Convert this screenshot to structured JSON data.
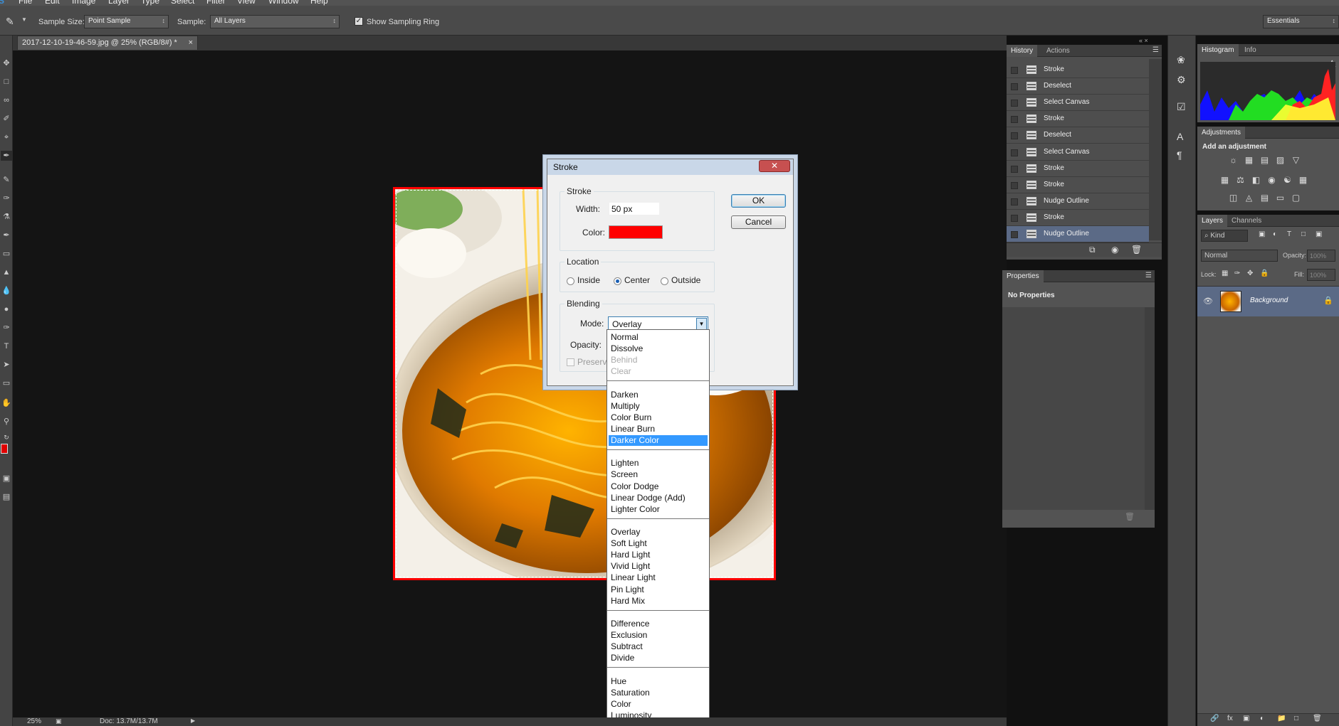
{
  "menu": [
    "File",
    "Edit",
    "Image",
    "Layer",
    "Type",
    "Select",
    "Filter",
    "View",
    "Window",
    "Help"
  ],
  "options": {
    "sample_size_label": "Sample Size:",
    "sample_size_value": "Point Sample",
    "sample_label": "Sample:",
    "sample_value": "All Layers",
    "show_ring_label": "Show Sampling Ring",
    "workspace": "Essentials"
  },
  "document": {
    "tab_title": "2017-12-10-19-46-59.jpg @ 25% (RGB/8#) *",
    "close_glyph": "×"
  },
  "status": {
    "zoom": "25%",
    "doc_info": "Doc: 13.7M/13.7M"
  },
  "stroke_dialog": {
    "title": "Stroke",
    "close_glyph": "✕",
    "stroke_group": "Stroke",
    "width_label": "Width:",
    "width_value": "50 px",
    "color_label": "Color:",
    "stroke_color": "#ff0000",
    "location_group": "Location",
    "loc_inside": "Inside",
    "loc_center": "Center",
    "loc_outside": "Outside",
    "blending_group": "Blending",
    "mode_label": "Mode:",
    "mode_value": "Overlay",
    "opacity_label": "Opacity:",
    "preserve_label": "Preserv",
    "ok": "OK",
    "cancel": "Cancel"
  },
  "blend_modes": [
    [
      "Normal",
      "Dissolve",
      "Behind",
      "Clear"
    ],
    [
      "Darken",
      "Multiply",
      "Color Burn",
      "Linear Burn",
      "Darker Color"
    ],
    [
      "Lighten",
      "Screen",
      "Color Dodge",
      "Linear Dodge (Add)",
      "Lighter Color"
    ],
    [
      "Overlay",
      "Soft Light",
      "Hard Light",
      "Vivid Light",
      "Linear Light",
      "Pin Light",
      "Hard Mix"
    ],
    [
      "Difference",
      "Exclusion",
      "Subtract",
      "Divide"
    ],
    [
      "Hue",
      "Saturation",
      "Color",
      "Luminosity"
    ]
  ],
  "blend_modes_disabled": [
    "Behind",
    "Clear"
  ],
  "blend_mode_highlighted": "Darker Color",
  "history": {
    "tabs": [
      "History",
      "Actions"
    ],
    "items": [
      "Stroke",
      "Deselect",
      "Select Canvas",
      "Stroke",
      "Deselect",
      "Select Canvas",
      "Stroke",
      "Stroke",
      "Nudge Outline",
      "Stroke",
      "Nudge Outline"
    ]
  },
  "properties": {
    "title": "Properties",
    "empty": "No Properties"
  },
  "histogram": {
    "tabs": [
      "Histogram",
      "Info"
    ],
    "warning_glyph": "⚠"
  },
  "adjustments": {
    "title": "Adjustments",
    "subtitle": "Add an adjustment"
  },
  "layers": {
    "tabs": [
      "Layers",
      "Channels"
    ],
    "kind": "⌕ Kind",
    "blend": "Normal",
    "opacity_label": "Opacity:",
    "opacity_value": "100%",
    "lock_label": "Lock:",
    "fill_label": "Fill:",
    "fill_value": "100%",
    "layer_name": "Background"
  }
}
